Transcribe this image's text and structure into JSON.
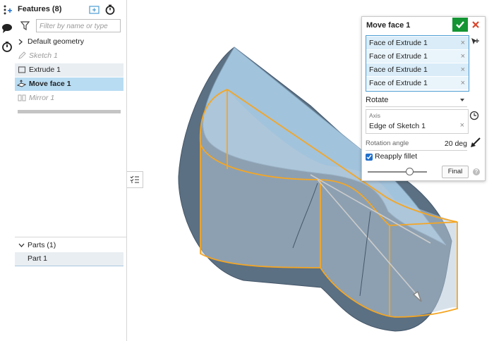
{
  "features_panel": {
    "title": "Features (8)",
    "filter_placeholder": "Filter by name or type",
    "items": [
      {
        "label": "Default geometry"
      },
      {
        "label": "Sketch 1"
      },
      {
        "label": "Extrude 1"
      },
      {
        "label": "Move face 1"
      },
      {
        "label": "Mirror 1"
      }
    ]
  },
  "parts_panel": {
    "title": "Parts (1)",
    "items": [
      {
        "label": "Part 1"
      }
    ]
  },
  "dialog": {
    "title": "Move face 1",
    "faces": [
      "Face of Extrude 1",
      "Face of Extrude 1",
      "Face of Extrude 1",
      "Face of Extrude 1"
    ],
    "remove_glyph": "×",
    "mode": "Rotate",
    "axis_caption": "Axis",
    "axis_value": "Edge of Sketch 1",
    "rotation_label": "Rotation angle",
    "rotation_value": "20 deg",
    "reapply_fillet_label": "Reapply fillet",
    "reapply_fillet_checked": true,
    "final_label": "Final",
    "help_glyph": "?"
  },
  "colors": {
    "accept": "#139534",
    "cancel": "#d9452b",
    "selection_highlight": "#f5a623",
    "model_body": "#5b7082",
    "model_face": "#a9cbe4",
    "row_selected": "#b8dcf2"
  }
}
